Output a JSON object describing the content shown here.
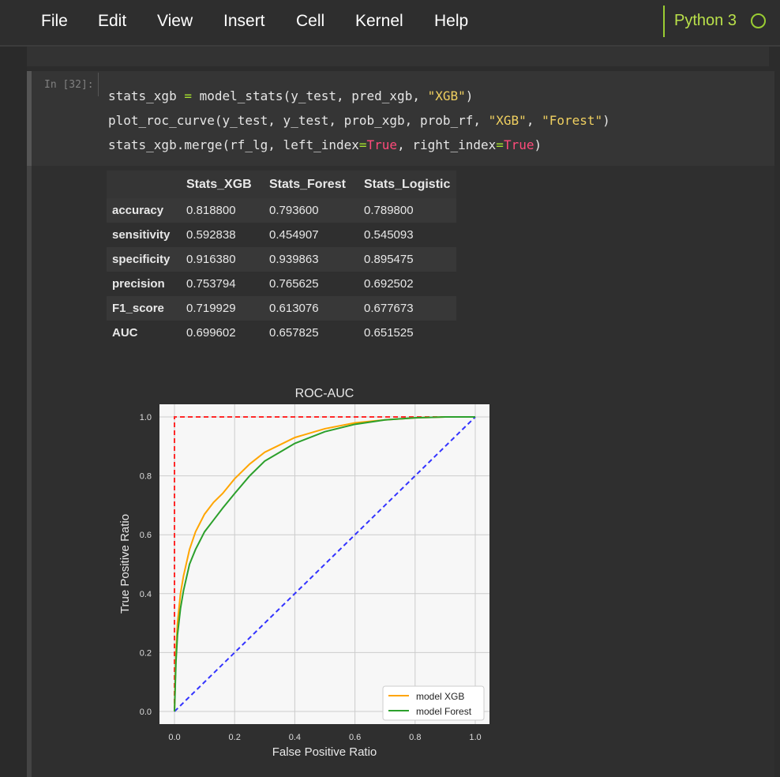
{
  "menu": {
    "items": [
      "File",
      "Edit",
      "View",
      "Insert",
      "Cell",
      "Kernel",
      "Help"
    ],
    "kernel": "Python 3"
  },
  "cell": {
    "prompt": "In [32]:",
    "lines": [
      "stats_xgb = model_stats(y_test, pred_xgb, \"XGB\")",
      "plot_roc_curve(y_test, y_test, prob_xgb, prob_rf, \"XGB\", \"Forest\")",
      "stats_xgb.merge(rf_lg, left_index=True, right_index=True)"
    ]
  },
  "table": {
    "columns": [
      "Stats_XGB",
      "Stats_Forest",
      "Stats_Logistic"
    ],
    "rows": [
      {
        "label": "accuracy",
        "values": [
          "0.818800",
          "0.793600",
          "0.789800"
        ]
      },
      {
        "label": "sensitivity",
        "values": [
          "0.592838",
          "0.454907",
          "0.545093"
        ]
      },
      {
        "label": "specificity",
        "values": [
          "0.916380",
          "0.939863",
          "0.895475"
        ]
      },
      {
        "label": "precision",
        "values": [
          "0.753794",
          "0.765625",
          "0.692502"
        ]
      },
      {
        "label": "F1_score",
        "values": [
          "0.719929",
          "0.613076",
          "0.677673"
        ]
      },
      {
        "label": "AUC",
        "values": [
          "0.699602",
          "0.657825",
          "0.651525"
        ]
      }
    ]
  },
  "chart_data": {
    "type": "line",
    "title": "ROC-AUC",
    "xlabel": "False Positive Ratio",
    "ylabel": "True Positive Ratio",
    "xlim": [
      0,
      1
    ],
    "ylim": [
      0,
      1
    ],
    "xticks": [
      "0.0",
      "0.2",
      "0.4",
      "0.6",
      "0.8",
      "1.0"
    ],
    "yticks": [
      "0.0",
      "0.2",
      "0.4",
      "0.6",
      "0.8",
      "1.0"
    ],
    "grid": true,
    "legend_position": "bottom-right",
    "series": [
      {
        "name": "model XGB",
        "color": "#ffa500",
        "x": [
          0,
          0.005,
          0.01,
          0.02,
          0.03,
          0.05,
          0.07,
          0.1,
          0.13,
          0.16,
          0.2,
          0.25,
          0.3,
          0.35,
          0.4,
          0.5,
          0.6,
          0.7,
          0.8,
          0.9,
          1.0
        ],
        "y": [
          0,
          0.2,
          0.3,
          0.4,
          0.46,
          0.55,
          0.61,
          0.67,
          0.71,
          0.74,
          0.79,
          0.84,
          0.88,
          0.905,
          0.93,
          0.96,
          0.98,
          0.99,
          0.997,
          1.0,
          1.0
        ]
      },
      {
        "name": "model Forest",
        "color": "#2ca02c",
        "x": [
          0,
          0.005,
          0.01,
          0.02,
          0.03,
          0.05,
          0.07,
          0.1,
          0.13,
          0.16,
          0.2,
          0.25,
          0.3,
          0.35,
          0.4,
          0.5,
          0.6,
          0.7,
          0.8,
          0.9,
          1.0
        ],
        "y": [
          0,
          0.17,
          0.26,
          0.35,
          0.41,
          0.5,
          0.55,
          0.61,
          0.65,
          0.69,
          0.74,
          0.8,
          0.85,
          0.88,
          0.91,
          0.95,
          0.975,
          0.99,
          0.997,
          1.0,
          1.0
        ]
      },
      {
        "color": "#ff2a2a",
        "style": "dashed",
        "x": [
          0,
          0,
          1
        ],
        "y": [
          0,
          1,
          1
        ]
      },
      {
        "color": "#3333ff",
        "style": "dashed",
        "x": [
          0,
          1
        ],
        "y": [
          0,
          1
        ]
      }
    ]
  }
}
